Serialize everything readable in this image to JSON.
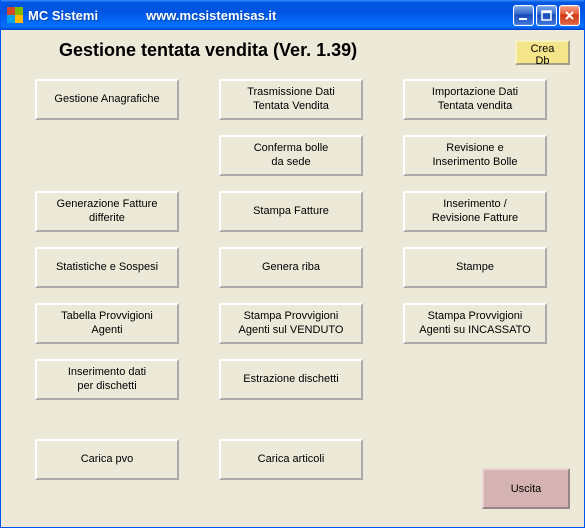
{
  "window": {
    "app_name": "MC Sistemi",
    "url": "www.mcsistemisas.it"
  },
  "header": {
    "title": "Gestione tentata vendita  (Ver. 1.39)",
    "crea_db": "Crea Db"
  },
  "buttons": {
    "r0c0": "Gestione Anagrafiche",
    "r0c1": "Trasmissione Dati\nTentata Vendita",
    "r0c2": "Importazione Dati\nTentata vendita",
    "r1c1": "Conferma bolle\nda sede",
    "r1c2": "Revisione e\nInserimento Bolle",
    "r2c0": "Generazione Fatture\ndifferite",
    "r2c1": "Stampa Fatture",
    "r2c2": "Inserimento /\nRevisione Fatture",
    "r3c0": "Statistiche e Sospesi",
    "r3c1": "Genera riba",
    "r3c2": "Stampe",
    "r4c0": "Tabella Provvigioni\nAgenti",
    "r4c1": "Stampa Provvigioni\nAgenti sul VENDUTO",
    "r4c2": "Stampa Provvigioni\nAgenti su INCASSATO",
    "r5c0": "Inserimento dati\nper dischetti",
    "r5c1": "Estrazione dischetti",
    "r6c0": "Carica pvo",
    "r6c1": "Carica articoli"
  },
  "exit": "Uscita",
  "colors": {
    "titlebar": "#0155e3",
    "client_bg": "#ece9d8",
    "crea_db_bg": "#f5e58a",
    "exit_bg": "#d6b3b3"
  }
}
